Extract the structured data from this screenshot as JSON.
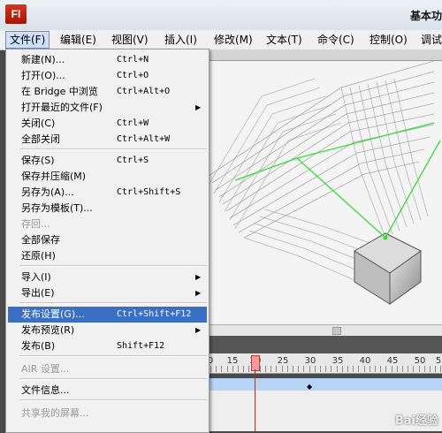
{
  "app": {
    "logo_text": "Fl",
    "workspace_label": "基本功"
  },
  "menubar": [
    {
      "label": "文件(F)"
    },
    {
      "label": "编辑(E)"
    },
    {
      "label": "视图(V)"
    },
    {
      "label": "插入(I)"
    },
    {
      "label": "修改(M)"
    },
    {
      "label": "文本(T)"
    },
    {
      "label": "命令(C)"
    },
    {
      "label": "控制(O)"
    },
    {
      "label": "调试"
    }
  ],
  "file_menu": [
    {
      "label": "新建(N)...",
      "shortcut": "Ctrl+N"
    },
    {
      "label": "打开(O)...",
      "shortcut": "Ctrl+O"
    },
    {
      "label": "在 Bridge 中浏览",
      "shortcut": "Ctrl+Alt+O"
    },
    {
      "label": "打开最近的文件(F)",
      "shortcut": "",
      "submenu": true
    },
    {
      "label": "关闭(C)",
      "shortcut": "Ctrl+W"
    },
    {
      "label": "全部关闭",
      "shortcut": "Ctrl+Alt+W"
    },
    {
      "label": "保存(S)",
      "shortcut": "Ctrl+S"
    },
    {
      "label": "保存并压缩(M)",
      "shortcut": ""
    },
    {
      "label": "另存为(A)...",
      "shortcut": "Ctrl+Shift+S"
    },
    {
      "label": "另存为模板(T)...",
      "shortcut": ""
    },
    {
      "label": "存回...",
      "shortcut": "",
      "disabled": true
    },
    {
      "label": "全部保存",
      "shortcut": ""
    },
    {
      "label": "还原(H)",
      "shortcut": ""
    },
    {
      "label": "导入(I)",
      "shortcut": "",
      "submenu": true
    },
    {
      "label": "导出(E)",
      "shortcut": "",
      "submenu": true
    },
    {
      "label": "发布设置(G)...",
      "shortcut": "Ctrl+Shift+F12",
      "highlighted": true
    },
    {
      "label": "发布预览(R)",
      "shortcut": "",
      "submenu": true
    },
    {
      "label": "发布(B)",
      "shortcut": "Shift+F12"
    },
    {
      "label": "AIR 设置...",
      "shortcut": "",
      "disabled": true
    },
    {
      "label": "文件信息...",
      "shortcut": ""
    },
    {
      "label": "共享我的屏幕...",
      "shortcut": "",
      "disabled": true
    }
  ],
  "timeline": {
    "ruler_labels": [
      "0",
      "15",
      "20",
      "25",
      "30",
      "35",
      "40",
      "45",
      "50",
      "5"
    ],
    "current_frame": 20
  },
  "watermark": "Bai经验",
  "colors": {
    "highlight": "#3a6fc4",
    "guide_line": "#33dd33",
    "playhead": "#d02020",
    "layer_row": "#b7d4f4"
  }
}
